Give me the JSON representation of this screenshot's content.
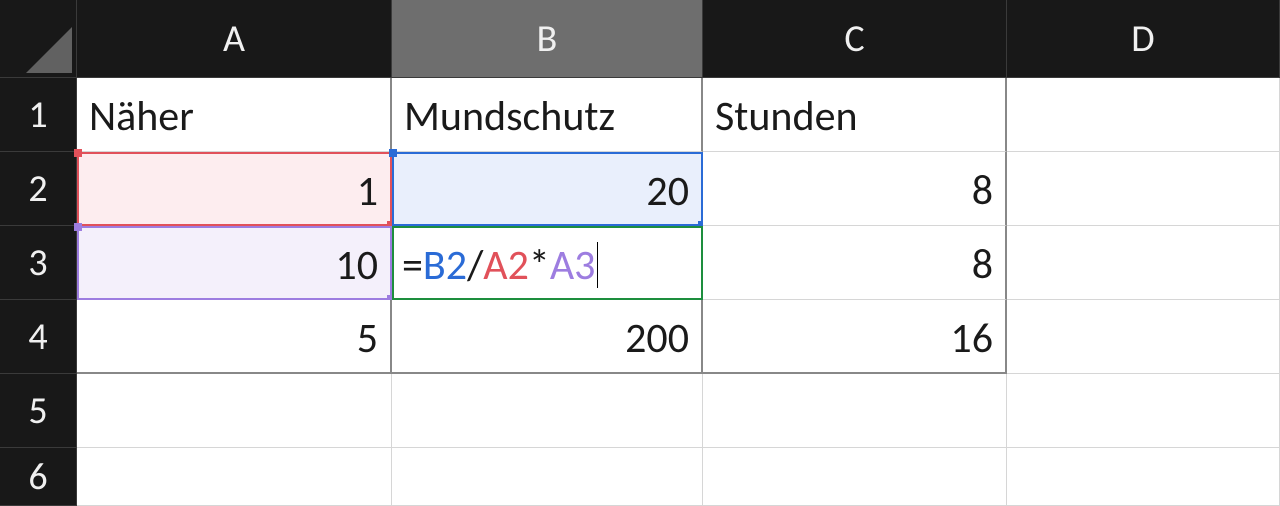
{
  "columns": [
    "A",
    "B",
    "C",
    "D"
  ],
  "rows": [
    "1",
    "2",
    "3",
    "4",
    "5",
    "6"
  ],
  "active": {
    "col": "B",
    "row": "3"
  },
  "cells": {
    "A1": "Näher",
    "B1": "Mundschutz",
    "C1": "Stunden",
    "A2": "1",
    "B2": "20",
    "C2": "8",
    "A3": "10",
    "C3": "8",
    "A4": "5",
    "B4": "200",
    "C4": "16"
  },
  "formula": {
    "prefix": "=",
    "ref1": "B2",
    "op1": "/",
    "ref2": "A2",
    "op2": "*",
    "ref3": "A3"
  }
}
